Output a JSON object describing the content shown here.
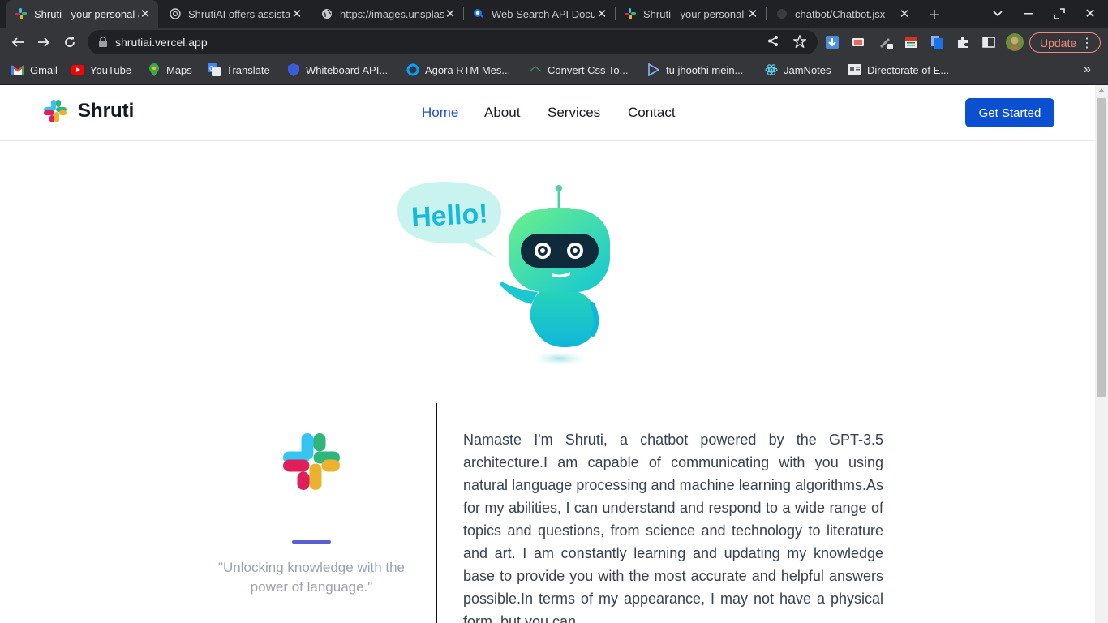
{
  "tabs": [
    {
      "title": "Shruti - your personal assistant",
      "active": true,
      "favicon": "slack-like-logo-icon"
    },
    {
      "title": "ShrutiAI offers assistance",
      "active": false,
      "favicon": "openai-icon"
    },
    {
      "title": "https://images.unsplash.com",
      "active": false,
      "favicon": "globe-icon"
    },
    {
      "title": "Web Search API Documentation",
      "active": false,
      "favicon": "search-api-icon"
    },
    {
      "title": "Shruti - your personal assistant",
      "active": false,
      "favicon": "slack-like-logo-icon"
    },
    {
      "title": "chatbot/Chatbot.jsx",
      "active": false,
      "favicon": "github-icon"
    }
  ],
  "toolbar": {
    "url": "shrutiai.vercel.app",
    "update_label": "Update"
  },
  "bookmarks": [
    {
      "label": "Gmail",
      "icon": "gmail-icon"
    },
    {
      "label": "YouTube",
      "icon": "youtube-icon"
    },
    {
      "label": "Maps",
      "icon": "maps-icon"
    },
    {
      "label": "Translate",
      "icon": "translate-icon"
    },
    {
      "label": "Whiteboard API...",
      "icon": "whiteboard-icon"
    },
    {
      "label": "Agora RTM Mes...",
      "icon": "agora-icon"
    },
    {
      "label": "Convert Css To...",
      "icon": "convert-icon"
    },
    {
      "label": "tu jhoothi mein...",
      "icon": "music-icon"
    },
    {
      "label": "JamNotes",
      "icon": "react-icon"
    },
    {
      "label": "Directorate of E...",
      "icon": "document-icon"
    }
  ],
  "site": {
    "brand": "Shruti",
    "nav": [
      "Home",
      "About",
      "Services",
      "Contact"
    ],
    "active_nav": "Home",
    "cta": "Get Started",
    "speech_bubble": "Hello!",
    "quote": "\"Unlocking knowledge with the power of language.\"",
    "intro": "Namaste I'm Shruti, a chatbot powered by the GPT-3.5 architecture.I am capable of communicating with you using natural language processing and machine learning algorithms.As for my abilities, I can understand and respond to a wide range of topics and questions, from science and technology to literature and art. I am constantly learning and updating my knowledge base to provide you with the most accurate and helpful answers possible.In terms of my appearance, I may not have a physical form, but you can"
  },
  "colors": {
    "primary": "#0b50d1",
    "nav_active": "#1d4ed8",
    "accent_bar": "#5b5fd6",
    "chrome_dark": "#202124",
    "chrome_mid": "#35363a"
  }
}
